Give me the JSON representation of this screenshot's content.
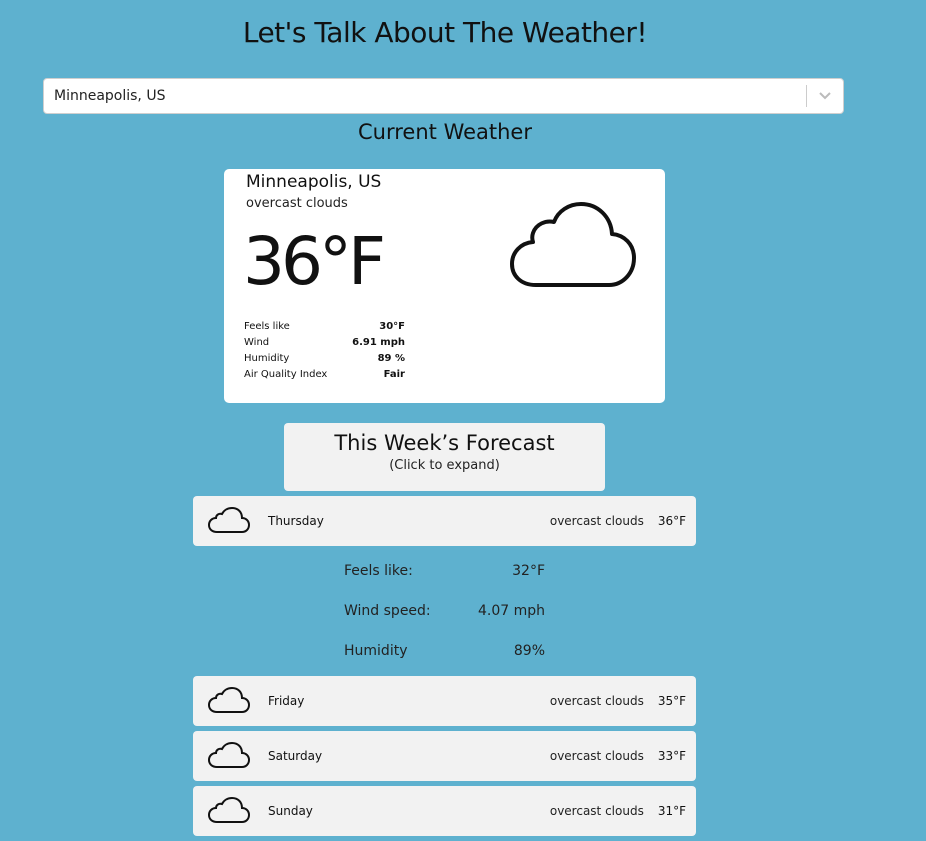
{
  "header": {
    "title": "Let's Talk About The Weather!"
  },
  "search": {
    "value": "Minneapolis, US"
  },
  "current": {
    "heading": "Current Weather",
    "city": "Minneapolis, US",
    "description": "overcast clouds",
    "temperature": "36°F",
    "icon": "cloud-icon",
    "details": [
      {
        "label": "Feels like",
        "value": "30°F"
      },
      {
        "label": "Wind",
        "value": "6.91 mph"
      },
      {
        "label": "Humidity",
        "value": "89 %"
      },
      {
        "label": "Air Quality Index",
        "value": "Fair"
      }
    ]
  },
  "forecast": {
    "title": "This Week’s Forecast",
    "subtitle": "(Click to expand)",
    "days": [
      {
        "day": "Thursday",
        "description": "overcast clouds",
        "temp": "36°F",
        "icon": "cloud-icon"
      },
      {
        "day": "Friday",
        "description": "overcast clouds",
        "temp": "35°F",
        "icon": "cloud-icon"
      },
      {
        "day": "Saturday",
        "description": "overcast clouds",
        "temp": "33°F",
        "icon": "cloud-icon"
      },
      {
        "day": "Sunday",
        "description": "overcast clouds",
        "temp": "31°F",
        "icon": "cloud-icon"
      }
    ],
    "expanded": [
      {
        "label": "Feels like:",
        "value": "32°F"
      },
      {
        "label": "Wind speed:",
        "value": "4.07 mph"
      },
      {
        "label": "Humidity",
        "value": "89%"
      }
    ]
  },
  "colors": {
    "background": "#5eb1cf",
    "card": "#ffffff",
    "row": "#f2f2f2"
  }
}
